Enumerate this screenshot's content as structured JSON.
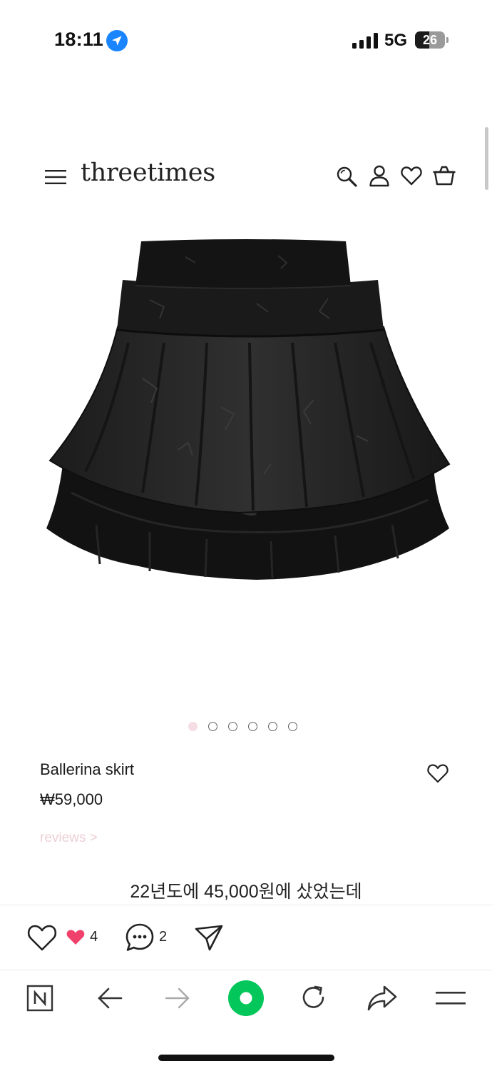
{
  "status_bar": {
    "time": "18:11",
    "network": "5G",
    "battery": "26"
  },
  "site": {
    "brand": "threetimes"
  },
  "product": {
    "name": "Ballerina skirt",
    "price": "₩59,000",
    "reviews_link": "reviews >",
    "image_count": 6,
    "active_image": 1
  },
  "post": {
    "caption": "22년도에 45,000원에 샀었는데",
    "like_count": "4",
    "comment_count": "2"
  },
  "icons": [
    "location-icon",
    "signal-icon",
    "menu-icon",
    "search-icon",
    "account-icon",
    "wishlist-icon",
    "cart-icon",
    "favorite-icon",
    "like-icon",
    "heart-badge-icon",
    "comment-icon",
    "share-icon",
    "browser-n-icon",
    "back-icon",
    "forward-icon",
    "home-icon",
    "refresh-icon",
    "share-browser-icon",
    "browser-menu-icon"
  ],
  "colors": {
    "location_blue": "#1a85ff",
    "home_green": "#03c75a",
    "like_pink": "#f0416d",
    "reviews_pink": "#eecfd6",
    "active_dot": "#f4dde3"
  }
}
